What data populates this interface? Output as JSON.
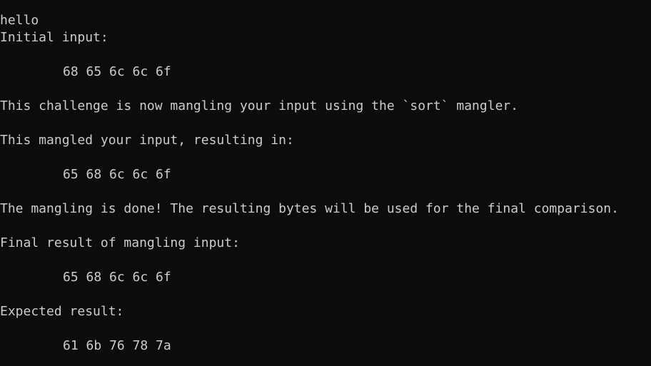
{
  "terminal": {
    "lines": {
      "echo": "hello",
      "initial_label": "Initial input:",
      "initial_bytes": "68 65 6c 6c 6f",
      "mangler_notice": "This challenge is now mangling your input using the `sort` mangler.",
      "mangled_label": "This mangled your input, resulting in:",
      "mangled_bytes": "65 68 6c 6c 6f",
      "done_notice": "The mangling is done! The resulting bytes will be used for the final comparison.",
      "final_label": "Final result of mangling input:",
      "final_bytes": "65 68 6c 6c 6f",
      "expected_label": "Expected result:",
      "expected_bytes": "61 6b 76 78 7a"
    }
  }
}
